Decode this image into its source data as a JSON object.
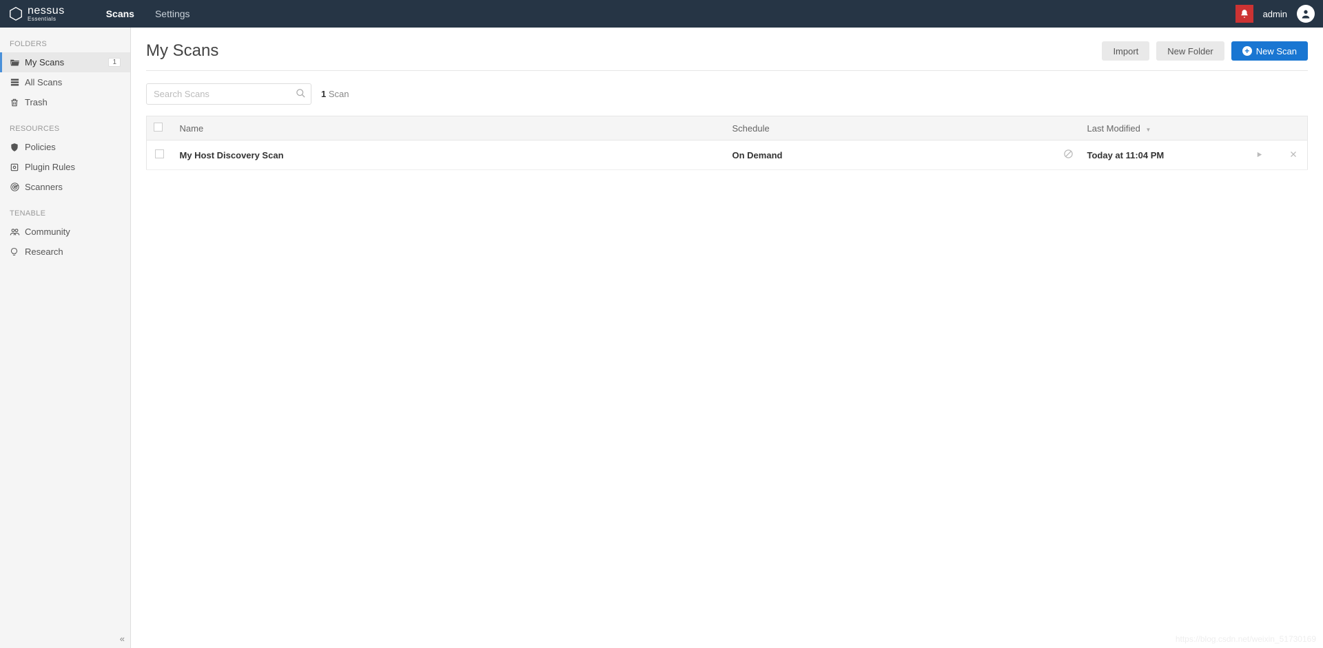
{
  "brand": {
    "name": "nessus",
    "tagline": "Essentials"
  },
  "topnav": {
    "scans": "Scans",
    "settings": "Settings"
  },
  "user": {
    "name": "admin"
  },
  "sidebar": {
    "groups": {
      "folders": {
        "label": "FOLDERS"
      },
      "resources": {
        "label": "RESOURCES"
      },
      "tenable": {
        "label": "TENABLE"
      }
    },
    "items": {
      "my_scans": {
        "label": "My Scans",
        "badge": "1"
      },
      "all_scans": {
        "label": "All Scans"
      },
      "trash": {
        "label": "Trash"
      },
      "policies": {
        "label": "Policies"
      },
      "plugin_rules": {
        "label": "Plugin Rules"
      },
      "scanners": {
        "label": "Scanners"
      },
      "community": {
        "label": "Community"
      },
      "research": {
        "label": "Research"
      }
    }
  },
  "page": {
    "title": "My Scans",
    "buttons": {
      "import": "Import",
      "new_folder": "New Folder",
      "new_scan": "New Scan"
    },
    "search_placeholder": "Search Scans",
    "count_number": "1",
    "count_word": "Scan"
  },
  "table": {
    "headers": {
      "name": "Name",
      "schedule": "Schedule",
      "last_modified": "Last Modified"
    },
    "rows": [
      {
        "name": "My Host Discovery Scan",
        "schedule": "On Demand",
        "last_modified": "Today at 11:04 PM"
      }
    ]
  },
  "watermark": "https://blog.csdn.net/weixin_51730169"
}
